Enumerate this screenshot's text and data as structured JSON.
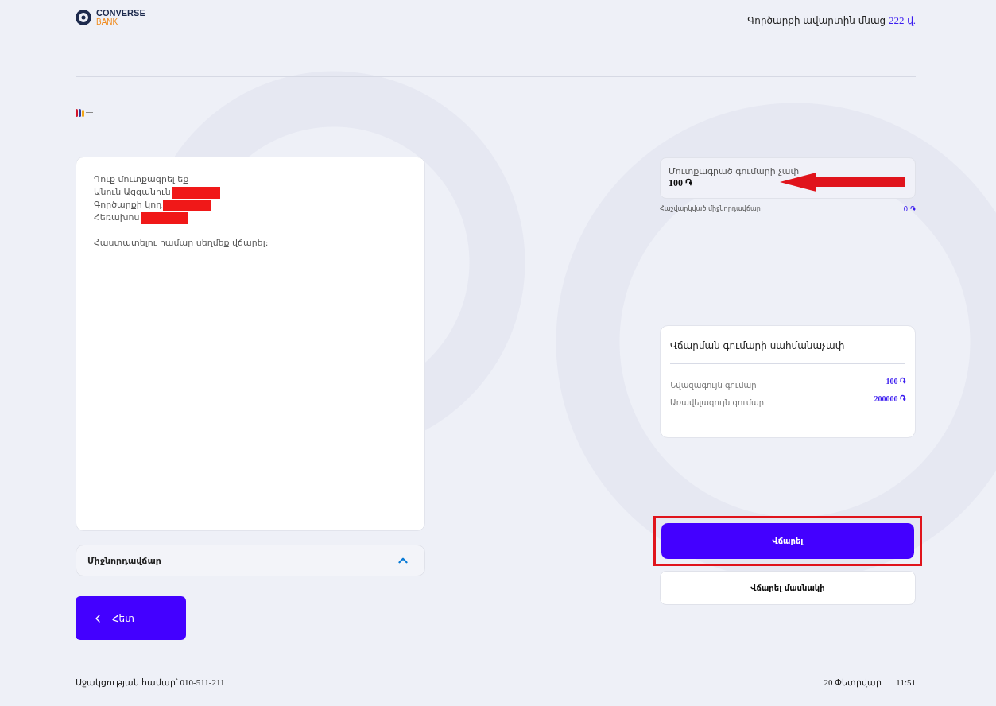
{
  "header": {
    "logo": {
      "name": "CONVERSE",
      "sub": "BANK"
    },
    "timer_label": "Գործարքի ավարտին մնաց",
    "timer_value": "222 վ."
  },
  "info": {
    "lines": [
      {
        "text": "Դուք մուտքագրել եք",
        "redacted": false
      },
      {
        "text": "Անուն Ազգանուն",
        "redacted": true
      },
      {
        "text": "Գործարքի կոդ",
        "redacted": true
      },
      {
        "text": "Հեռախոս",
        "redacted": true
      }
    ],
    "note": "Հաստատելու համար սեղմեք վճարել:"
  },
  "amount": {
    "label": "Մուտքագրած գումարի չափ",
    "value": "100 ֏",
    "arrow_annotation": true
  },
  "fee": {
    "label": "Հաշվարկված միջնորդավճար",
    "value": "0 ֏"
  },
  "limits": {
    "title": "Վճարման գումարի սահմանաչափ",
    "rows": [
      {
        "label": "Նվազագույն գումար",
        "value": "100 ֏"
      },
      {
        "label": "Առավելագույն գումար",
        "value": "200000 ֏"
      }
    ]
  },
  "accordion": {
    "label": "Միջնորդավճար",
    "expanded": true
  },
  "actions": [
    {
      "label": "Վճարել",
      "kind": "primary",
      "highlighted": true
    },
    {
      "label": "Վճարել մասնակի",
      "kind": "secondary",
      "highlighted": false
    }
  ],
  "back": {
    "label": "Հետ"
  },
  "footer": {
    "support": "Աջակցության համար՝ 010-511-211",
    "date": "20 Փետրվար",
    "time": "11:51"
  }
}
